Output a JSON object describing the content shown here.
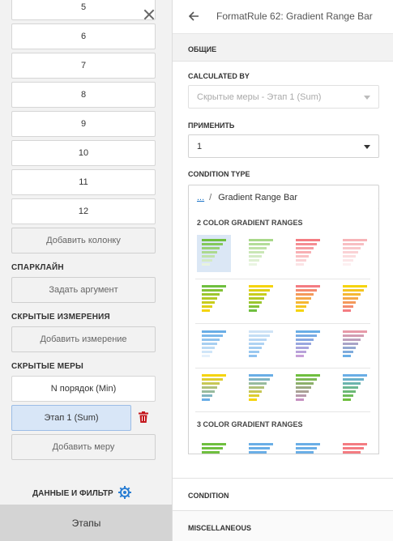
{
  "left_panel": {
    "columns": [
      "5",
      "6",
      "7",
      "8",
      "9",
      "10",
      "11",
      "12"
    ],
    "add_column": "Добавить колонку",
    "sparkline_title": "СПАРКЛАЙН",
    "set_argument": "Задать аргумент",
    "hidden_dimensions_title": "СКРЫТЫЕ ИЗМЕРЕНИЯ",
    "add_dimension": "Добавить измерение",
    "hidden_measures_title": "СКРЫТЫЕ МЕРЫ",
    "measures": [
      "N порядок (Min)",
      "Этап 1 (Sum)"
    ],
    "add_measure": "Добавить меру",
    "data_filter": "ДАННЫЕ И ФИЛЬТР",
    "bottom_tab": "Этапы"
  },
  "right_panel": {
    "title": "FormatRule 62: Gradient Range Bar",
    "general_section": "ОБЩИЕ",
    "calculated_by_label": "CALCULATED BY",
    "calculated_by_value": "Скрытые меры - Этап 1 (Sum)",
    "apply_label": "ПРИМЕНИТЬ",
    "apply_value": "1",
    "condition_type_label": "CONDITION TYPE",
    "breadcrumb_ellipsis": "...",
    "breadcrumb_sep": "/",
    "condition_type_value": "Gradient Range Bar",
    "gallery_header_2": "2 COLOR GRADIENT RANGES",
    "gallery_header_3": "3 COLOR GRADIENT RANGES",
    "condition_section": "CONDITION",
    "misc_section": "MISCELLANEOUS"
  },
  "colors": {
    "selected_bg": "#d8e6f7",
    "trash_red": "#c4161c",
    "gear_blue": "#2a7ed3",
    "link_blue": "#1a73c7"
  }
}
